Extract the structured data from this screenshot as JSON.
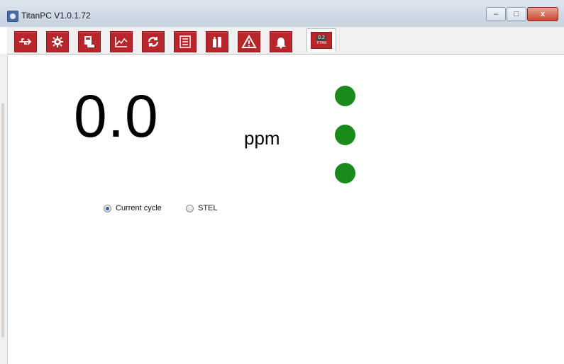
{
  "window": {
    "title": "TitanPC V1.0.1.72"
  },
  "window_buttons": {
    "minimize": "–",
    "maximize": "□",
    "close": "x"
  },
  "toolbar": {
    "items": [
      {
        "icon": "usb-icon"
      },
      {
        "icon": "gear-icon"
      },
      {
        "icon": "device-info-icon"
      },
      {
        "icon": "graph-icon"
      },
      {
        "icon": "refresh-icon"
      },
      {
        "icon": "list-icon"
      },
      {
        "icon": "cylinder-icon"
      },
      {
        "icon": "warning-icon"
      },
      {
        "icon": "bell-icon"
      },
      {
        "icon": "titan-display-icon",
        "active": true,
        "display_value": "0.2",
        "display_label": "TITAN"
      }
    ],
    "accent": "#b8262c"
  },
  "main": {
    "reading": "0.0",
    "unit": "ppm",
    "indicators": [
      {
        "color": "#1a8a1a"
      },
      {
        "color": "#1a8a1a"
      },
      {
        "color": "#1a8a1a"
      }
    ],
    "modes": [
      {
        "label": "Current cycle",
        "selected": true
      },
      {
        "label": "STEL",
        "selected": false
      }
    ]
  }
}
